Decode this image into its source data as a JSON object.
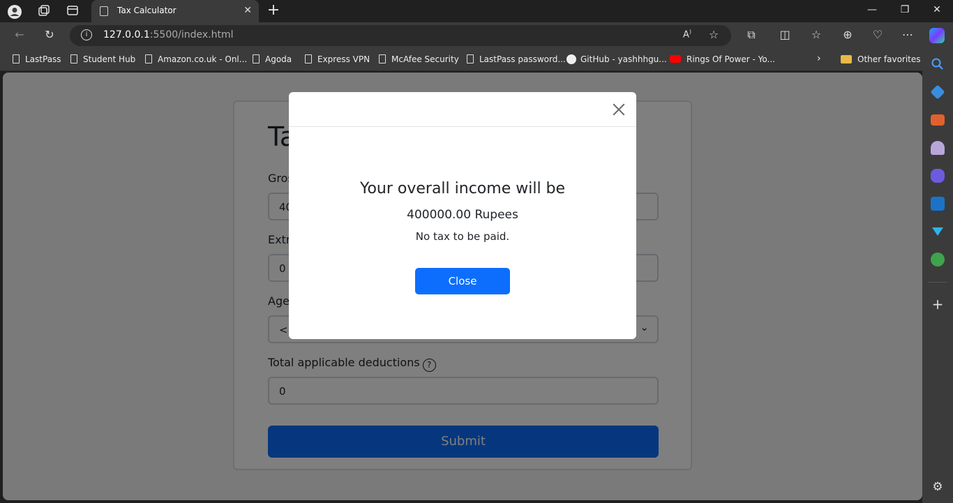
{
  "browser": {
    "tab_title": "Tax Calculator",
    "url_host": "127.0.0.1",
    "url_path": ":5500/index.html"
  },
  "bookmarks": [
    {
      "label": "LastPass",
      "icon": "page-icon"
    },
    {
      "label": "Student Hub",
      "icon": "page-icon"
    },
    {
      "label": "Amazon.co.uk - Onl...",
      "icon": "page-icon"
    },
    {
      "label": "Agoda",
      "icon": "page-icon"
    },
    {
      "label": "Express VPN",
      "icon": "page-icon"
    },
    {
      "label": "McAfee Security",
      "icon": "page-icon"
    },
    {
      "label": "LastPass password...",
      "icon": "page-icon"
    },
    {
      "label": "GitHub - yashhhgu...",
      "icon": "github-icon"
    },
    {
      "label": "Rings Of Power - Yo...",
      "icon": "youtube-icon"
    },
    {
      "label": "Other favorites",
      "icon": "folder-icon"
    }
  ],
  "form": {
    "title": "Ta",
    "gross_label": "Gros",
    "gross_value": "40",
    "extra_label": "Extr",
    "extra_value": "0",
    "age_label": "Age",
    "age_value": "< 4",
    "deductions_label": "Total applicable deductions",
    "deductions_value": "0",
    "help_glyph": "?",
    "submit_label": "Submit"
  },
  "modal": {
    "heading": "Your overall income will be",
    "amount": "400000.00 Rupees",
    "note": "No tax to be paid.",
    "close_label": "Close"
  },
  "colors": {
    "primary": "#0d6efd",
    "chrome": "#3b3b3b"
  }
}
